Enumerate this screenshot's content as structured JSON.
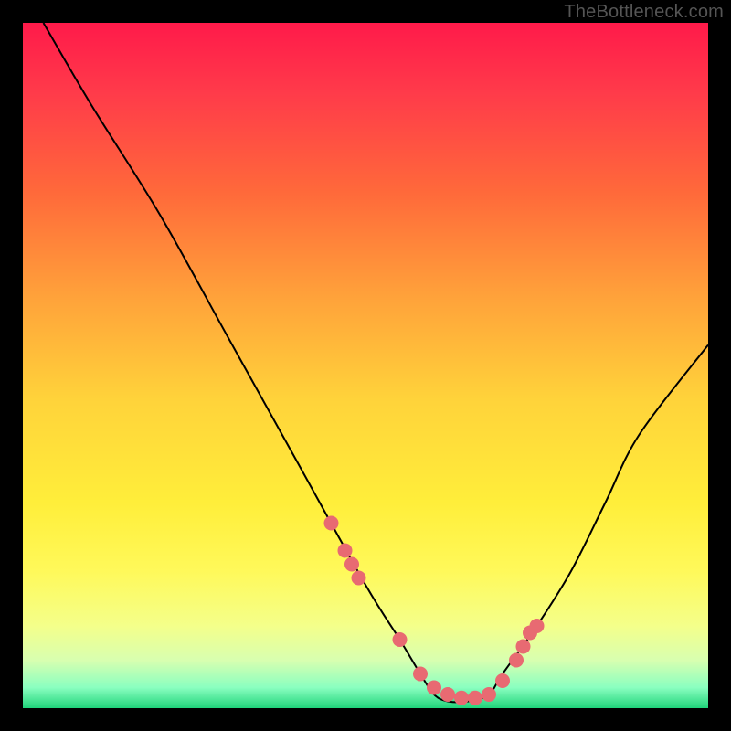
{
  "watermark": "TheBottleneck.com",
  "chart_data": {
    "type": "line",
    "title": "",
    "xlabel": "",
    "ylabel": "",
    "xlim": [
      0,
      100
    ],
    "ylim": [
      0,
      100
    ],
    "series": [
      {
        "name": "curve",
        "x": [
          3,
          10,
          20,
          30,
          40,
          50,
          55,
          58,
          60,
          62,
          65,
          68,
          70,
          75,
          80,
          85,
          90,
          100
        ],
        "y": [
          100,
          88,
          72,
          54,
          36,
          18,
          10,
          5,
          2,
          1,
          1,
          2,
          5,
          12,
          20,
          30,
          40,
          53
        ]
      }
    ],
    "markers": {
      "name": "highlight-dots",
      "x": [
        45,
        47,
        48,
        49,
        55,
        58,
        60,
        62,
        64,
        66,
        68,
        70,
        72,
        73,
        74,
        75
      ],
      "y": [
        27,
        23,
        21,
        19,
        10,
        5,
        3,
        2,
        1.5,
        1.5,
        2,
        4,
        7,
        9,
        11,
        12
      ]
    },
    "marker_color": "#e86a72",
    "curve_color": "#000000"
  }
}
